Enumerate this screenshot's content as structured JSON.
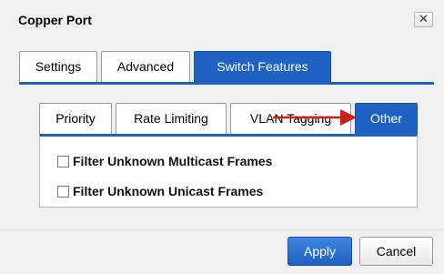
{
  "dialog": {
    "title": "Copper Port",
    "close_glyph": "✕"
  },
  "outer_tabs": [
    {
      "label": "Settings",
      "active": false
    },
    {
      "label": "Advanced",
      "active": false
    },
    {
      "label": "Switch Features",
      "active": true
    }
  ],
  "inner_tabs": [
    {
      "label": "Priority",
      "active": false
    },
    {
      "label": "Rate Limiting",
      "active": false
    },
    {
      "label": "VLAN Tagging",
      "active": false
    },
    {
      "label": "Other",
      "active": true
    }
  ],
  "options": [
    {
      "label": "Filter Unknown Multicast Frames",
      "checked": false
    },
    {
      "label": "Filter Unknown Unicast Frames",
      "checked": false
    }
  ],
  "buttons": {
    "apply": "Apply",
    "cancel": "Cancel"
  },
  "colors": {
    "accent": "#1f62c4",
    "annotation_arrow": "#cc1f1f"
  }
}
